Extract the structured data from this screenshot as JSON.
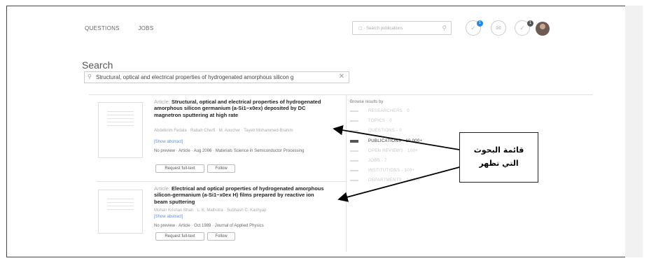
{
  "nav": {
    "questions": "QUESTIONS",
    "jobs": "JOBS"
  },
  "search": {
    "placeholder": "Search publications"
  },
  "header_icons": {
    "notifications_badge": "1",
    "requests_badge": "1",
    "accent_color": "#1e88e5",
    "badge_dark_color": "#555555"
  },
  "page": {
    "title": "Search",
    "query": "Structural, optical and electrical properties of hydrogenated amorphous silicon g"
  },
  "results": [
    {
      "type": "Article:",
      "title": "Structural, optical and electrical properties of hydrogenated amorphous silicon germanium (a-Si1−x0ex) deposited by DC magnetron sputtering at high rate",
      "authors": "Abdelkrim Fedala · Rabah Cherfi · M. Aoucher · Tayeb Mohammed-Brahim",
      "show_abstract": "[Show abstract]",
      "meta": "No preview · Article · Aug 2006 · Materials Science in Semiconductor Processing",
      "request_label": "Request full-text",
      "follow_label": "Follow"
    },
    {
      "type": "Article:",
      "title": "Electrical and optical properties of hydrogenated amorphous silicon-germanium (a-Si1−x0ex H) films prepared by reactive ion beam sputtering",
      "authors": "Mohan Krishan Bhan · L. K. Malhotra · Subhash C. Kashyap",
      "show_abstract": "[Show abstract]",
      "meta": "No preview · Article · Oct 1989 · Journal of Applied Physics",
      "request_label": "Request full-text",
      "follow_label": "Follow"
    }
  ],
  "browse": {
    "title": "Browse results by",
    "items": [
      {
        "label": "RESEARCHERS · 0",
        "active": false
      },
      {
        "label": "TOPICS · 0",
        "active": false
      },
      {
        "label": "QUESTIONS · 0",
        "active": false
      },
      {
        "label": "PUBLICATIONS · 10,000+",
        "active": true
      },
      {
        "label": "OPEN REVIEWS · 100+",
        "active": false
      },
      {
        "label": "JOBS · 7",
        "active": false
      },
      {
        "label": "INSTITUTIONS · 100+",
        "active": false
      },
      {
        "label": "DEPARTMENTS · 1,000+",
        "active": false
      }
    ]
  },
  "annotation": {
    "line1": "قائمة البحوث",
    "line2": "التي تظهر"
  }
}
